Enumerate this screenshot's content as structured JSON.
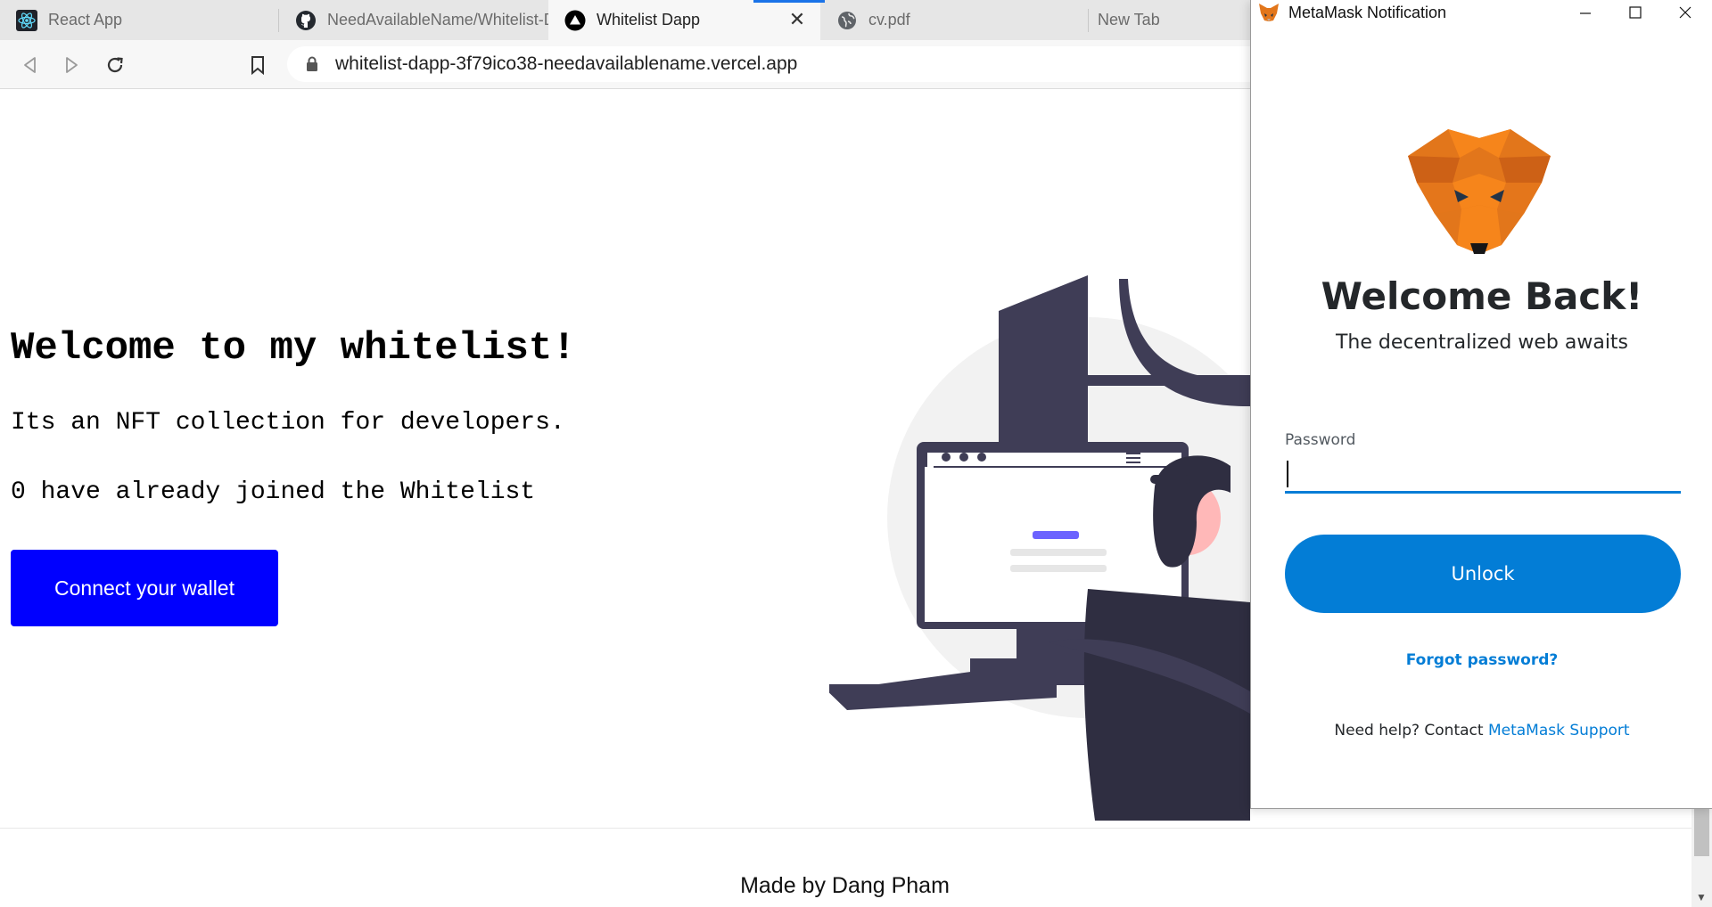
{
  "browser": {
    "tabs": [
      {
        "label": "React App",
        "icon": "react-icon",
        "active": false
      },
      {
        "label": "NeedAvailableName/Whitelist-D",
        "icon": "github-icon",
        "active": false
      },
      {
        "label": "Whitelist Dapp",
        "icon": "vercel-triangle-icon",
        "active": true
      },
      {
        "label": "cv.pdf",
        "icon": "globe-icon",
        "active": false
      },
      {
        "label": "New Tab",
        "icon": "",
        "active": false
      }
    ],
    "close_tab_glyph": "✕",
    "url": "whitelist-dapp-3f79ico38-needavailablename.vercel.app"
  },
  "page": {
    "title": "Welcome to my whitelist!",
    "description": "Its an NFT collection for developers.",
    "joined_text": "0 have already joined the Whitelist",
    "connect_button": "Connect your wallet",
    "footer": "Made by Dang Pham"
  },
  "metamask": {
    "window_title": "MetaMask Notification",
    "heading": "Welcome Back!",
    "subheading": "The decentralized web awaits",
    "password_label": "Password",
    "password_value": "",
    "unlock_button": "Unlock",
    "forgot_link": "Forgot password?",
    "help_prefix": "Need help? Contact",
    "help_link": "MetaMask Support"
  },
  "colors": {
    "connect_button": "#0000ff",
    "metamask_blue": "#037dd6",
    "illustration_dark": "#3f3d56",
    "illustration_accent": "#6c63ff"
  }
}
